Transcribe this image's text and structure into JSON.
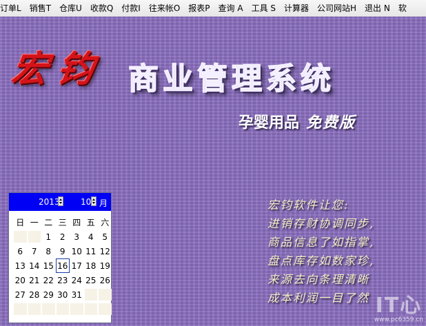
{
  "menubar": {
    "items": [
      "订单L",
      "销售T",
      "仓库U",
      "收款Q",
      "付款I",
      "往来帐O",
      "报表P",
      "查询 A",
      "工具 S",
      "计算器",
      "公司网站H",
      "退出 N",
      "软"
    ]
  },
  "logo": {
    "brand": "宏钧",
    "title": "商业管理系统",
    "subtitle": "孕婴用品",
    "edition": "免费版"
  },
  "poem": {
    "lines": [
      "宏钧软件让您:",
      "进销存财协调同步,",
      "商品信息了如指掌,",
      "盘点库存如数家珍,",
      "来源去向条理清晰",
      "成本利润一目了然"
    ]
  },
  "watermark": {
    "mark": "IT心",
    "url": "www.pc6359.cn"
  },
  "calendar": {
    "year": "2013",
    "month": "10",
    "month_suffix": "月",
    "weekdays": [
      "日",
      "一",
      "二",
      "三",
      "四",
      "五",
      "六"
    ],
    "weeks": [
      [
        "",
        "",
        "1",
        "2",
        "3",
        "4",
        "5"
      ],
      [
        "6",
        "7",
        "8",
        "9",
        "10",
        "11",
        "12"
      ],
      [
        "13",
        "14",
        "15",
        "16",
        "17",
        "18",
        "19"
      ],
      [
        "20",
        "21",
        "22",
        "23",
        "24",
        "25",
        "26"
      ],
      [
        "27",
        "28",
        "29",
        "30",
        "31",
        "",
        ""
      ],
      [
        "",
        "",
        "",
        "",
        "",
        "",
        ""
      ]
    ],
    "today": "16"
  }
}
